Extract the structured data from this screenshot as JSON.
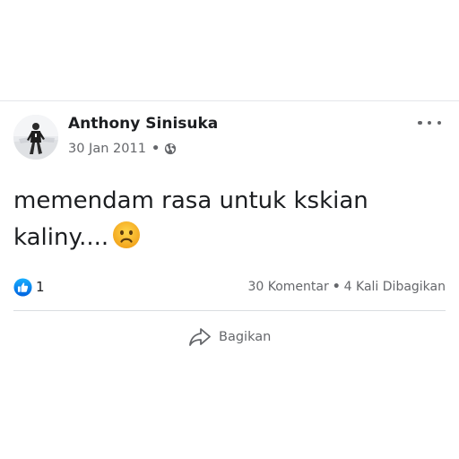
{
  "post": {
    "author": "Anthony Sinisuka",
    "date": "30 Jan 2011",
    "meta_separator": "•",
    "privacy_icon": "globe-icon",
    "more_icon": "more-horizontal-icon",
    "text": "memendam rasa untuk kskian\nkaliny....",
    "emoji": "sad-face-emoji"
  },
  "stats": {
    "reaction_icon": "like-reaction-icon",
    "like_count": "1",
    "comments": "30 Komentar",
    "separator": "•",
    "shares": "4 Kali Dibagikan"
  },
  "actions": {
    "share_label": "Bagikan",
    "share_icon": "share-arrow-icon"
  },
  "colors": {
    "primary_text": "#1c1e21",
    "secondary_text": "#65676b",
    "like_blue": "#1877f2",
    "divider": "#dadde1",
    "emoji_yellow": "#f7b125"
  }
}
